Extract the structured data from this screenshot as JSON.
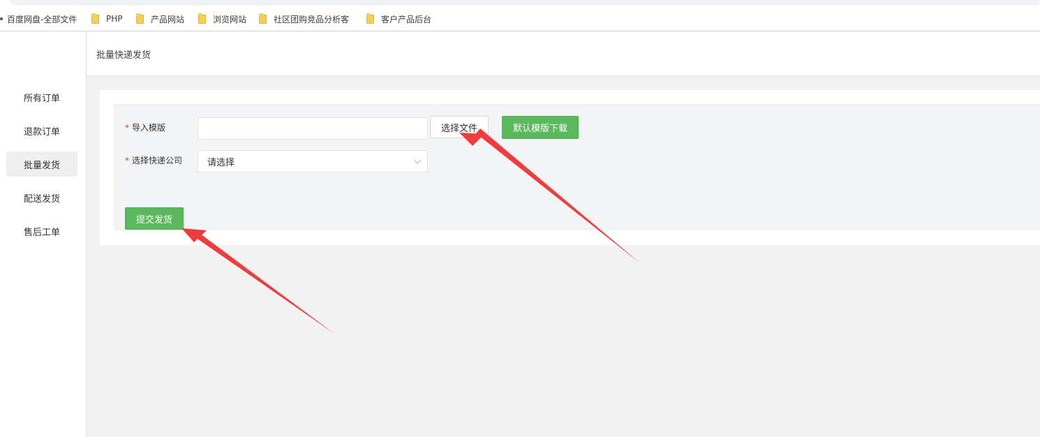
{
  "bookmarks": [
    {
      "label": "百度网盘-全部文件",
      "icon": "bullet-icon"
    },
    {
      "label": "PHP",
      "icon": "folder-icon"
    },
    {
      "label": "产品网站",
      "icon": "folder-icon"
    },
    {
      "label": "浏览网站",
      "icon": "folder-icon"
    },
    {
      "label": "社区团购竞品分析客",
      "icon": "folder-icon"
    },
    {
      "label": "客户产品后台",
      "icon": "folder-icon"
    }
  ],
  "sidebar": {
    "items": [
      {
        "label": "所有订单"
      },
      {
        "label": "退款订单"
      },
      {
        "label": "批量发货",
        "active": true
      },
      {
        "label": "配送发货"
      },
      {
        "label": "售后工单"
      }
    ]
  },
  "header": {
    "title": "批量快递发货"
  },
  "form": {
    "required_mark": "*",
    "import_label": "导入模版",
    "choose_file_label": "选择文件",
    "download_template_label": "默认模版下载",
    "courier_label": "选择快递公司",
    "courier_select_value": "请选择",
    "submit_label": "提交发货"
  },
  "colors": {
    "primary_green": "#5cb85c",
    "required_red": "#e4393c",
    "annotation_arrow": "#f03c3c",
    "active_sidebar_bg": "#efefef",
    "content_bg": "#f2f2f2"
  }
}
